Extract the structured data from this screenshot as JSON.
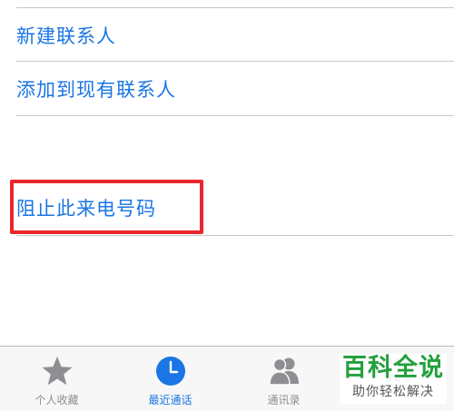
{
  "menu": {
    "new_contact": "新建联系人",
    "add_to_existing": "添加到现有联系人",
    "block_caller": "阻止此来电号码"
  },
  "tabbar": {
    "favorites": "个人收藏",
    "recents": "最近通话",
    "contacts": "通讯录",
    "active_tab": "recents",
    "icons": [
      "star-icon",
      "clock-icon",
      "contacts-icon",
      "keypad-icon"
    ]
  },
  "watermark": {
    "title": "百科全说",
    "subtitle": "助你轻松解决"
  },
  "colors": {
    "accent": "#1a76e4",
    "highlight": "#e8262c",
    "inactive": "#8e8e93",
    "watermark": "#23a03c"
  }
}
